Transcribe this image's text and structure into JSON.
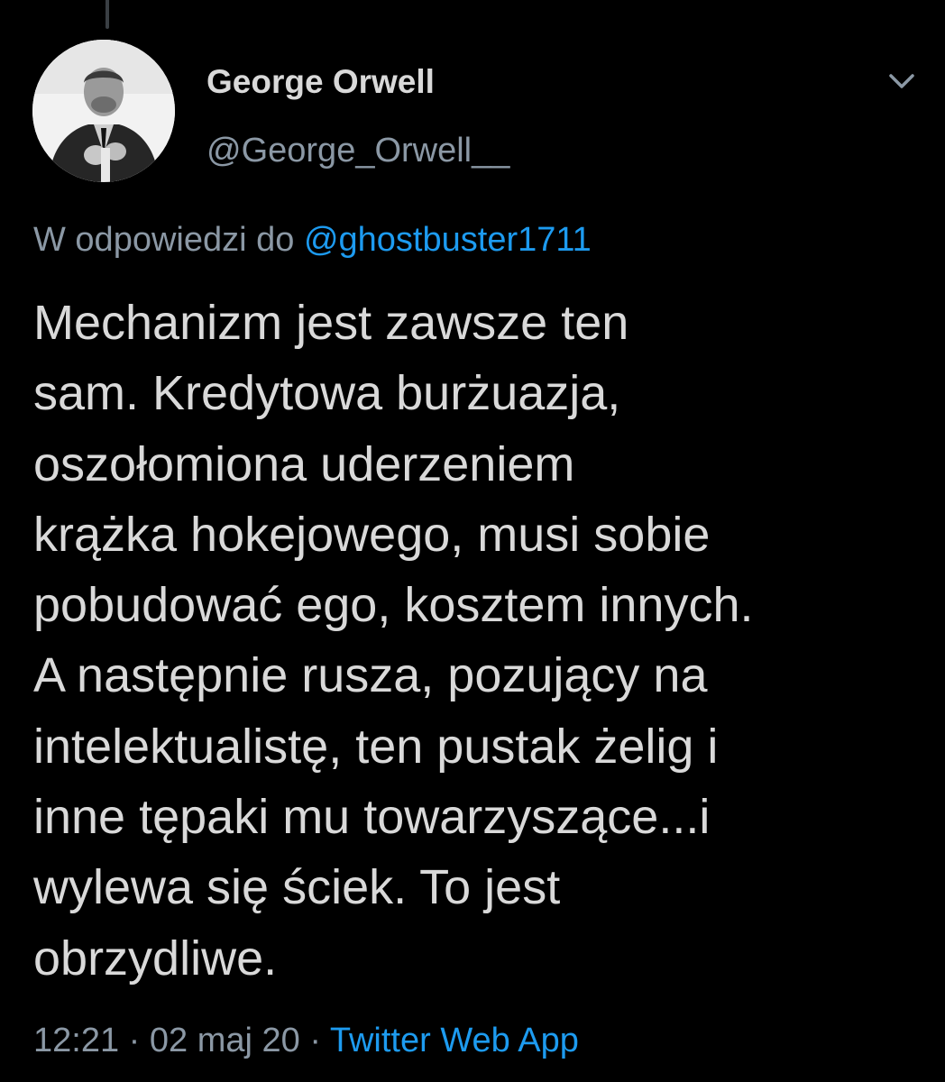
{
  "tweet": {
    "author_name": "George Orwell",
    "author_handle": "@George_Orwell__",
    "reply_prefix": "W odpowiedzi do",
    "reply_to": "@ghostbuster1711",
    "body_lines": [
      "Mechanizm jest zawsze ten",
      "sam. Kredytowa burżuazja,",
      "oszołomiona uderzeniem",
      "krążka hokejowego, musi sobie",
      "pobudować ego, kosztem innych.",
      "A następnie rusza, pozujący na",
      "intelektualistę, ten pustak żelig i",
      "inne tępaki mu towarzyszące...i",
      "wylewa się ściek. To jest",
      "obrzydliwe."
    ],
    "time": "12:21",
    "separator": "·",
    "date": "02 maj 20",
    "source": "Twitter Web App"
  },
  "icons": {
    "menu": "chevron-down-icon",
    "avatar": "avatar"
  },
  "colors": {
    "background": "#000000",
    "text": "#d9d9d9",
    "secondary": "#8b98a5",
    "link": "#1d9bf0"
  }
}
